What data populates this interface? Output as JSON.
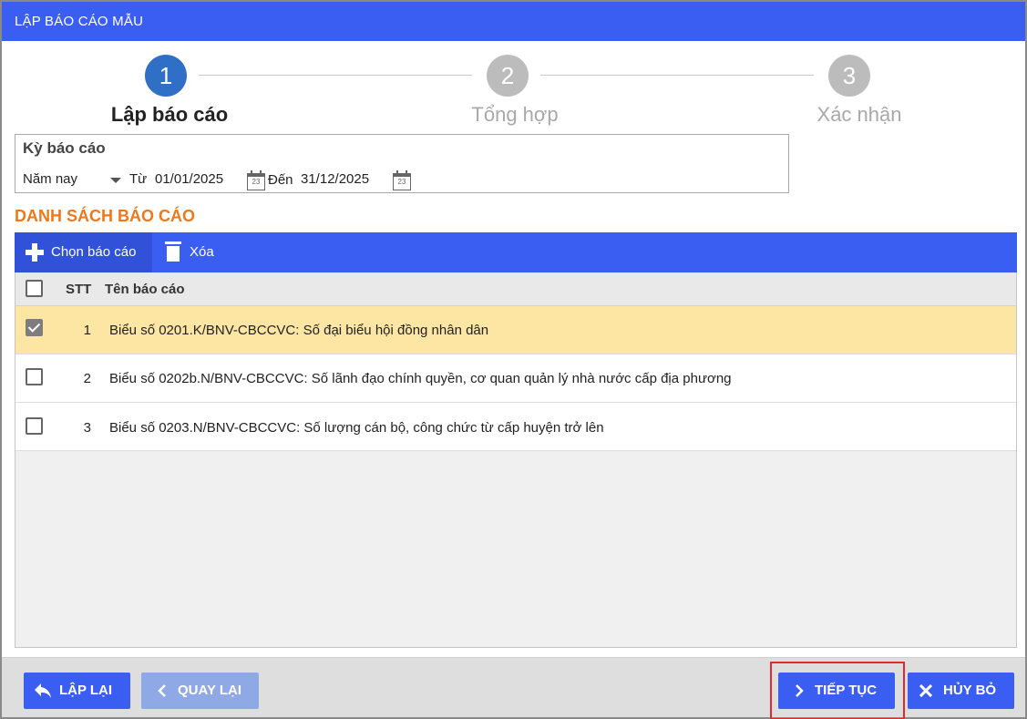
{
  "window": {
    "title": "LẬP BÁO CÁO MẪU"
  },
  "stepper": {
    "steps": [
      {
        "number": "1",
        "label": "Lập báo cáo",
        "state": "active"
      },
      {
        "number": "2",
        "label": "Tổng hợp",
        "state": "inactive"
      },
      {
        "number": "3",
        "label": "Xác nhận",
        "state": "inactive"
      }
    ]
  },
  "period": {
    "title": "Kỳ báo cáo",
    "selected": "Năm nay",
    "from_label": "Từ",
    "from_value": "01/01/2025",
    "to_label": "Đến",
    "to_value": "31/12/2025",
    "calendar_icon_text": "23"
  },
  "list": {
    "title": "DANH SÁCH BÁO CÁO",
    "toolbar": {
      "add_label": "Chọn báo cáo",
      "delete_label": "Xóa"
    },
    "columns": {
      "stt": "STT",
      "name": "Tên báo cáo"
    },
    "rows": [
      {
        "stt": "1",
        "name": "Biểu số 0201.K/BNV-CBCCVC: Số đại biểu hội đồng nhân dân",
        "checked": true
      },
      {
        "stt": "2",
        "name": "Biểu số 0202b.N/BNV-CBCCVC: Số lãnh đạo chính quyền, cơ quan quản lý nhà nước cấp địa phương",
        "checked": false
      },
      {
        "stt": "3",
        "name": "Biểu số 0203.N/BNV-CBCCVC: Số lượng cán bộ, công chức từ cấp huyện trở lên",
        "checked": false
      }
    ]
  },
  "footer": {
    "reset_label": "LẬP LẠI",
    "back_label": "QUAY LẠI",
    "next_label": "TIẾP TỤC",
    "cancel_label": "HỦY BỎ"
  },
  "colors": {
    "primary": "#3b5ef2",
    "step_active": "#2f6fc6",
    "step_inactive": "#bcbcbc",
    "accent_orange": "#f07818",
    "selected_row": "#fde6a3",
    "highlight_red": "#e8262b"
  }
}
